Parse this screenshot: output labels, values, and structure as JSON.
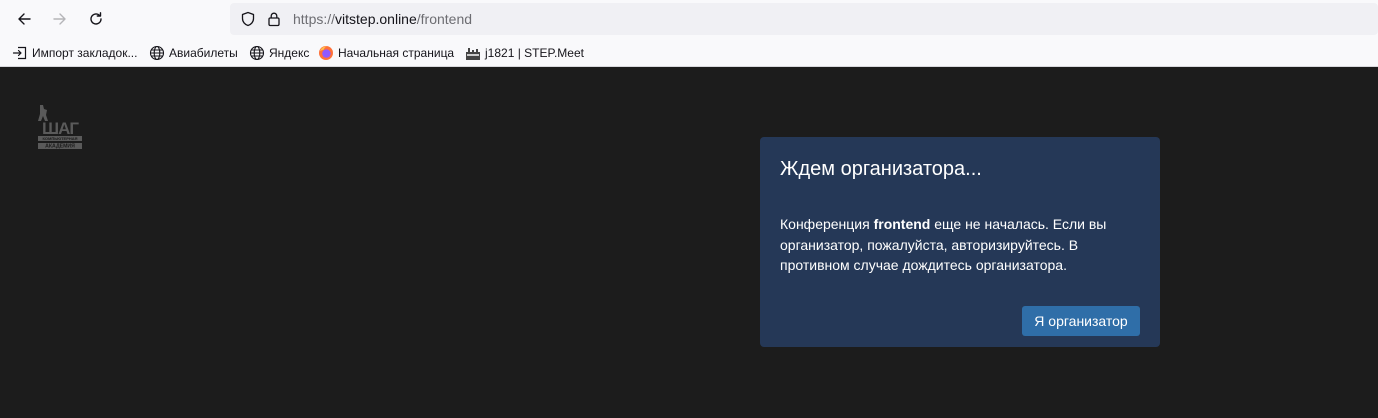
{
  "browser": {
    "url_prefix": "https://",
    "url_host": "vitstep.online",
    "url_path": "/frontend",
    "bookmarks": [
      {
        "label": "Импорт закладок...",
        "icon": "import-icon"
      },
      {
        "label": "Авиабилеты",
        "icon": "globe-icon"
      },
      {
        "label": "Яндекс",
        "icon": "globe-icon"
      },
      {
        "label": "Начальная страница",
        "icon": "firefox-icon"
      },
      {
        "label": "j1821 | STEP.Meet",
        "icon": "step-logo-icon"
      }
    ]
  },
  "logo": {
    "line1": "ШАГ",
    "line2": "компьютерная",
    "line3": "академия"
  },
  "dialog": {
    "title": "Ждем организатора...",
    "body_before": "Конференция ",
    "body_bold": "frontend",
    "body_after": " еще не началась. Если вы организатор, пожалуйста, авторизируйтесь. В противном случае дождитесь организатора.",
    "button_label": "Я организатор"
  },
  "colors": {
    "page_bg": "#1c1c1c",
    "dialog_bg": "#253857",
    "button_bg": "#2f6ea8"
  }
}
